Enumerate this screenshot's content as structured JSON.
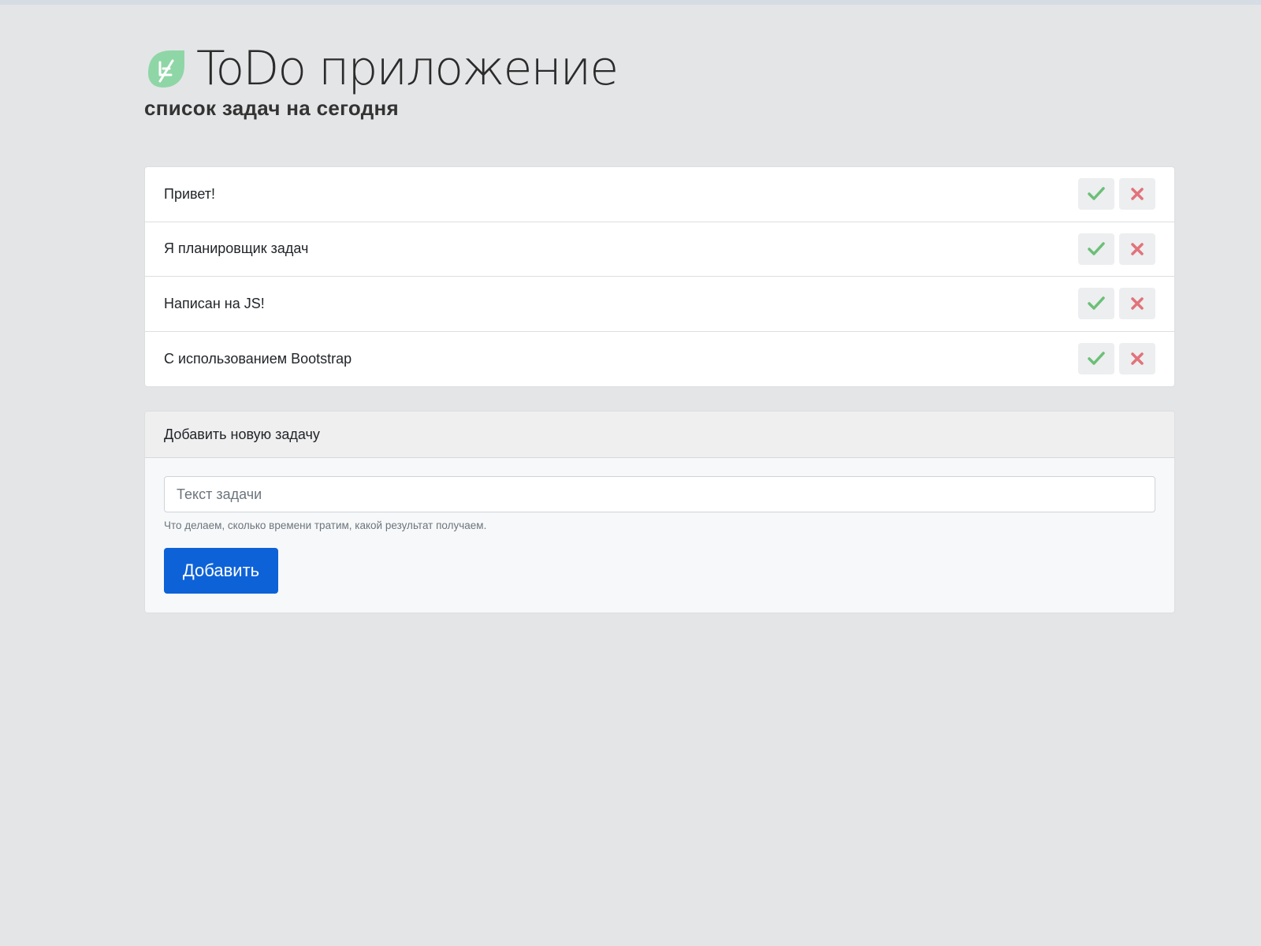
{
  "header": {
    "logo_icon": "leaf-logo-icon",
    "title": "ToDo приложение",
    "subtitle": "список задач на сегодня"
  },
  "tasks": [
    {
      "text": "Привет!"
    },
    {
      "text": "Я планировщик задач"
    },
    {
      "text": "Написан на JS!"
    },
    {
      "text": "С использованием Bootstrap"
    }
  ],
  "task_actions": {
    "complete_icon": "check-icon",
    "delete_icon": "close-icon"
  },
  "add_form": {
    "header": "Добавить новую задачу",
    "input_placeholder": "Текст задачи",
    "input_value": "",
    "help_text": "Что делаем, сколько времени тратим, какой результат получаем.",
    "submit_label": "Добавить"
  },
  "colors": {
    "background": "#e4e5e7",
    "primary": "#0d62d8",
    "check": "#6cbf78",
    "delete": "#e2727a",
    "logo": "#8fd6a6"
  }
}
